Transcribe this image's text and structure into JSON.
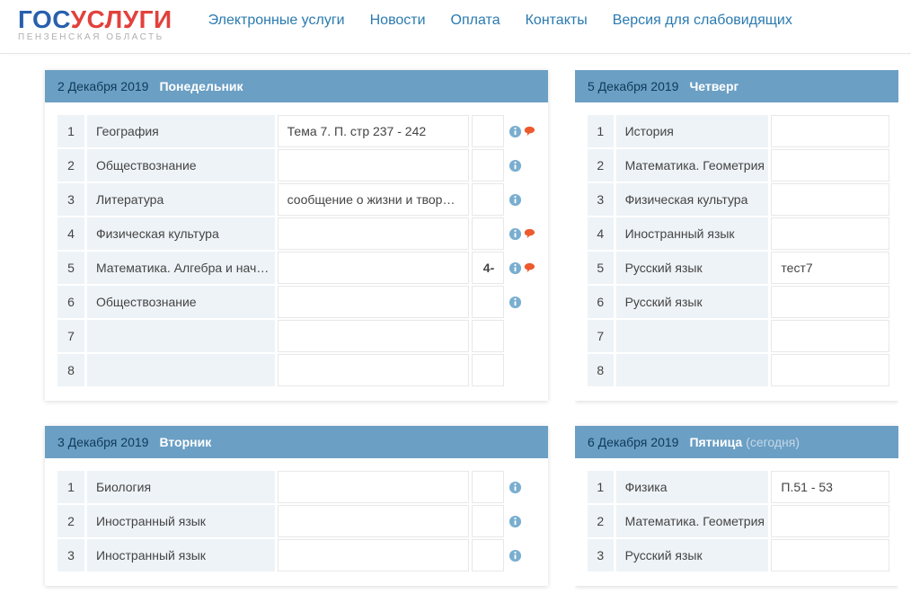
{
  "header": {
    "logo_gos": "ГОС",
    "logo_usl": "УСЛУГИ",
    "logo_sub": "ПЕНЗЕНСКАЯ ОБЛАСТЬ",
    "nav": {
      "services": "Электронные услуги",
      "news": "Новости",
      "payment": "Оплата",
      "contacts": "Контакты",
      "accessibility": "Версия для слабовидящих"
    }
  },
  "today_label": "(сегодня)",
  "days": {
    "mon": {
      "date": "2 Декабря 2019",
      "dow": "Понедельник",
      "rows": [
        {
          "n": "1",
          "subj": "География",
          "hw": "Тема 7. П. стр 237 - 242",
          "grade": "",
          "info": true,
          "comment": true
        },
        {
          "n": "2",
          "subj": "Обществознание",
          "hw": "",
          "grade": "",
          "info": true,
          "comment": false
        },
        {
          "n": "3",
          "subj": "Литература",
          "hw": "сообщение о жизни и твор…",
          "grade": "",
          "info": true,
          "comment": false
        },
        {
          "n": "4",
          "subj": "Физическая культура",
          "hw": "",
          "grade": "",
          "info": true,
          "comment": true
        },
        {
          "n": "5",
          "subj": "Математика. Алгебра и нач…",
          "hw": "",
          "grade": "4-",
          "info": true,
          "comment": true
        },
        {
          "n": "6",
          "subj": "Обществознание",
          "hw": "",
          "grade": "",
          "info": true,
          "comment": false
        },
        {
          "n": "7",
          "subj": "",
          "hw": "",
          "grade": "",
          "info": false,
          "comment": false
        },
        {
          "n": "8",
          "subj": "",
          "hw": "",
          "grade": "",
          "info": false,
          "comment": false
        }
      ]
    },
    "tue": {
      "date": "3 Декабря 2019",
      "dow": "Вторник",
      "rows": [
        {
          "n": "1",
          "subj": "Биология",
          "hw": "",
          "grade": "",
          "info": true,
          "comment": false
        },
        {
          "n": "2",
          "subj": "Иностранный язык",
          "hw": "",
          "grade": "",
          "info": true,
          "comment": false
        },
        {
          "n": "3",
          "subj": "Иностранный язык",
          "hw": "",
          "grade": "",
          "info": true,
          "comment": false
        }
      ]
    },
    "thu": {
      "date": "5 Декабря 2019",
      "dow": "Четверг",
      "rows": [
        {
          "n": "1",
          "subj": "История",
          "hw": ""
        },
        {
          "n": "2",
          "subj": "Математика. Геометрия",
          "hw": ""
        },
        {
          "n": "3",
          "subj": "Физическая культура",
          "hw": ""
        },
        {
          "n": "4",
          "subj": "Иностранный язык",
          "hw": ""
        },
        {
          "n": "5",
          "subj": "Русский язык",
          "hw": "тест7"
        },
        {
          "n": "6",
          "subj": "Русский язык",
          "hw": ""
        },
        {
          "n": "7",
          "subj": "",
          "hw": ""
        },
        {
          "n": "8",
          "subj": "",
          "hw": ""
        }
      ]
    },
    "fri": {
      "date": "6 Декабря 2019",
      "dow": "Пятница",
      "today": true,
      "rows": [
        {
          "n": "1",
          "subj": "Физика",
          "hw": "П.51 - 53"
        },
        {
          "n": "2",
          "subj": "Математика. Геометрия",
          "hw": ""
        },
        {
          "n": "3",
          "subj": "Русский язык",
          "hw": ""
        }
      ]
    }
  }
}
